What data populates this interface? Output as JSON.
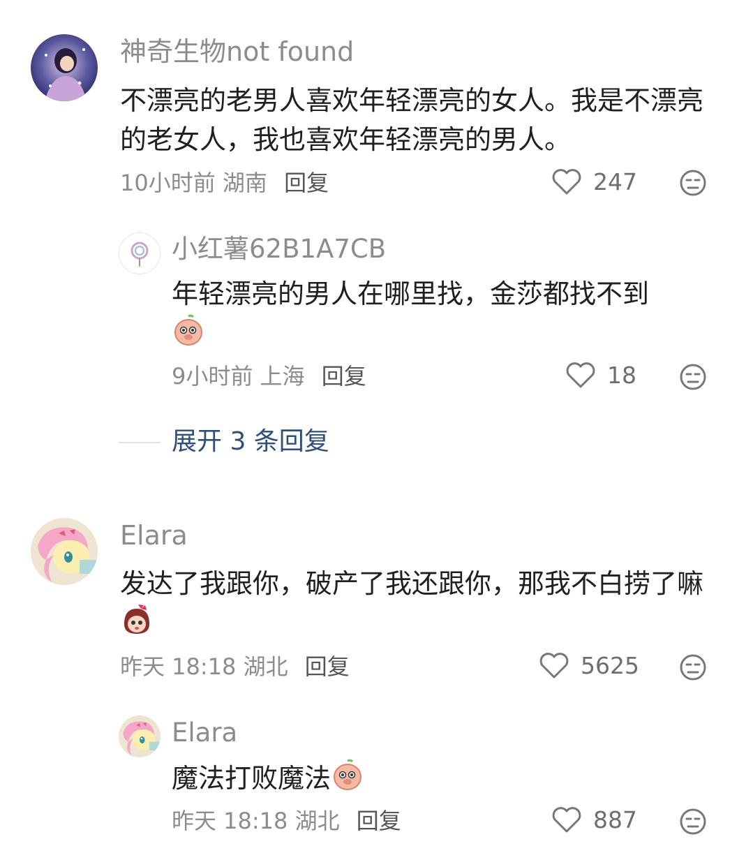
{
  "comments": [
    {
      "username": "神奇生物not found",
      "text": "不漂亮的老男人喜欢年轻漂亮的女人。我是不漂亮的老女人，我也喜欢年轻漂亮的男人。",
      "time": "10小时前",
      "location": "湖南",
      "reply_label": "回复",
      "likes": "247",
      "replies": [
        {
          "username": "小红薯62B1A7CB",
          "text": "年轻漂亮的男人在哪里找，金莎都找不到",
          "emoji": "peach-face-emoji",
          "time": "9小时前",
          "location": "上海",
          "reply_label": "回复",
          "likes": "18"
        }
      ],
      "expand_label": "展开 3 条回复"
    },
    {
      "username": "Elara",
      "text": "发达了我跟你，破产了我还跟你，那我不白捞了嘛",
      "emoji": "girl-face-emoji",
      "time": "昨天 18:18",
      "location": "湖北",
      "reply_label": "回复",
      "likes": "5625",
      "replies": [
        {
          "username": "Elara",
          "text": "魔法打败魔法",
          "emoji": "peach-face-emoji",
          "time": "昨天 18:18",
          "location": "湖北",
          "reply_label": "回复",
          "likes": "887"
        }
      ]
    }
  ],
  "icons": {
    "like": "heart-outline-icon",
    "dislike": "meh-face-icon"
  },
  "colors": {
    "username": "#8c8c8c",
    "body_text": "#1f1f1f",
    "expand_link": "#2e4f7a"
  }
}
